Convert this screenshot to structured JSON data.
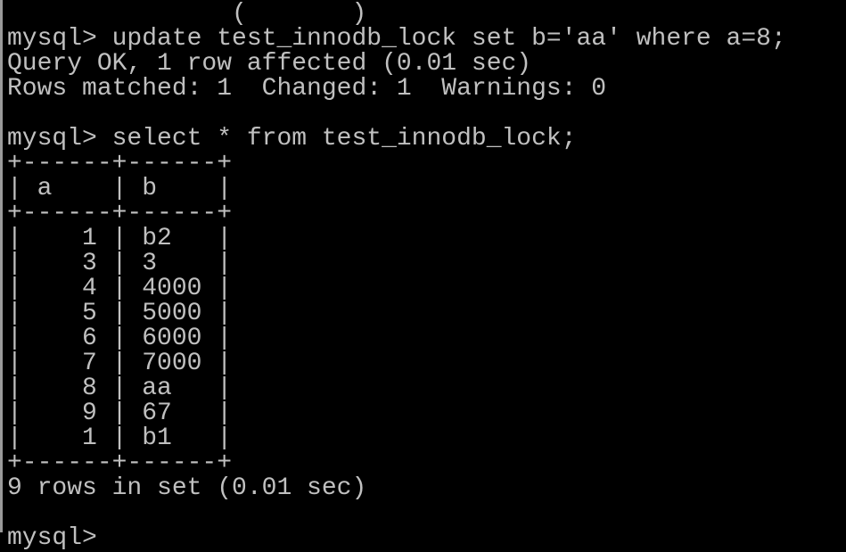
{
  "terminal": {
    "lines": [
      "               (       )",
      "mysql> update test_innodb_lock set b='aa' where a=8;",
      "Query OK, 1 row affected (0.01 sec)",
      "Rows matched: 1  Changed: 1  Warnings: 0",
      "",
      "mysql> select * from test_innodb_lock;",
      "+------+------+",
      "| a    | b    |",
      "+------+------+",
      "|    1 | b2   |",
      "|    3 | 3    |",
      "|    4 | 4000 |",
      "|    5 | 5000 |",
      "|    6 | 6000 |",
      "|    7 | 7000 |",
      "|    8 | aa   |",
      "|    9 | 67   |",
      "|    1 | b1   |",
      "+------+------+",
      "9 rows in set (0.01 sec)",
      "",
      "mysql>"
    ]
  },
  "colors": {
    "background": "#000000",
    "text": "#c0c0c0"
  }
}
